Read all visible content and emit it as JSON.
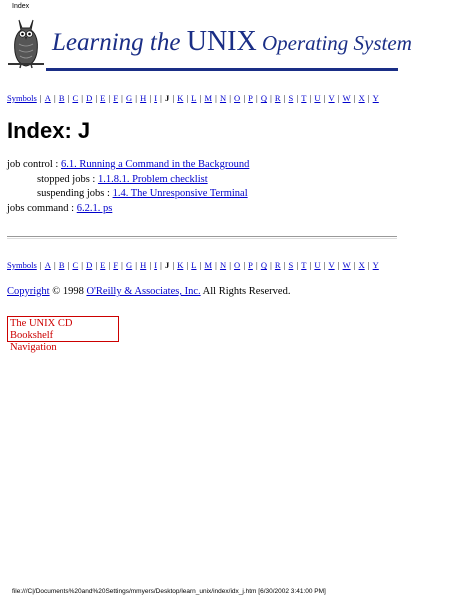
{
  "print_header": "Index",
  "banner": {
    "part1": "Learning the ",
    "part2": "UNIX",
    "part3": " Operating System",
    "color": "#1a2e86"
  },
  "index_nav": [
    "Symbols",
    "A",
    "B",
    "C",
    "D",
    "E",
    "F",
    "G",
    "H",
    "I",
    "J",
    "K",
    "L",
    "M",
    "N",
    "O",
    "P",
    "Q",
    "R",
    "S",
    "T",
    "U",
    "V",
    "W",
    "X",
    "Y"
  ],
  "current_letter": "J",
  "page_title": "Index: J",
  "entries": [
    {
      "term": "job control",
      "link": "6.1. Running a Command in the Background",
      "sub": false
    },
    {
      "term": "stopped jobs",
      "link": "1.1.8.1. Problem checklist",
      "sub": true
    },
    {
      "term": "suspending jobs",
      "link": "1.4. The Unresponsive Terminal",
      "sub": true
    },
    {
      "term": "jobs command",
      "link": "6.2.1. ps",
      "sub": false
    }
  ],
  "copyright": {
    "link": "Copyright",
    "text": " © 1998 ",
    "publisher": "O'Reilly & Associates, Inc.",
    "rights": " All Rights Reserved."
  },
  "cd_bookshelf": {
    "line1": "The UNIX CD Bookshelf",
    "line2": "Navigation"
  },
  "footer": "file:///C|/Documents%20and%20Settings/mmyers/Desktop/learn_unix/index/idx_j.htm [6/30/2002 3:41:00 PM]"
}
